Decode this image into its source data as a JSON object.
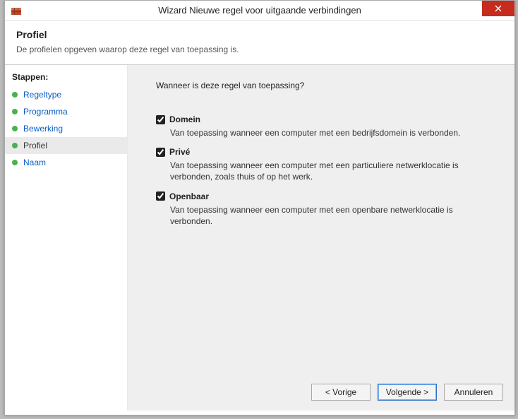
{
  "window": {
    "title": "Wizard Nieuwe regel voor uitgaande verbindingen"
  },
  "header": {
    "page_title": "Profiel",
    "page_sub": "De profielen opgeven waarop deze regel van toepassing is."
  },
  "sidebar": {
    "steps_header": "Stappen:",
    "items": [
      {
        "label": "Regeltype",
        "selected": false
      },
      {
        "label": "Programma",
        "selected": false
      },
      {
        "label": "Bewerking",
        "selected": false
      },
      {
        "label": "Profiel",
        "selected": true
      },
      {
        "label": "Naam",
        "selected": false
      }
    ]
  },
  "main": {
    "prompt": "Wanneer is deze regel van toepassing?",
    "options": [
      {
        "label": "Domein",
        "checked": true,
        "desc": "Van toepassing wanneer een computer met een bedrijfsdomein is verbonden."
      },
      {
        "label": "Privé",
        "checked": true,
        "desc": "Van toepassing wanneer een computer met een particuliere netwerklocatie is verbonden, zoals thuis of op het werk."
      },
      {
        "label": "Openbaar",
        "checked": true,
        "desc": "Van toepassing wanneer een computer met een openbare netwerklocatie is verbonden."
      }
    ]
  },
  "footer": {
    "back": "< Vorige",
    "next": "Volgende >",
    "cancel": "Annuleren"
  }
}
